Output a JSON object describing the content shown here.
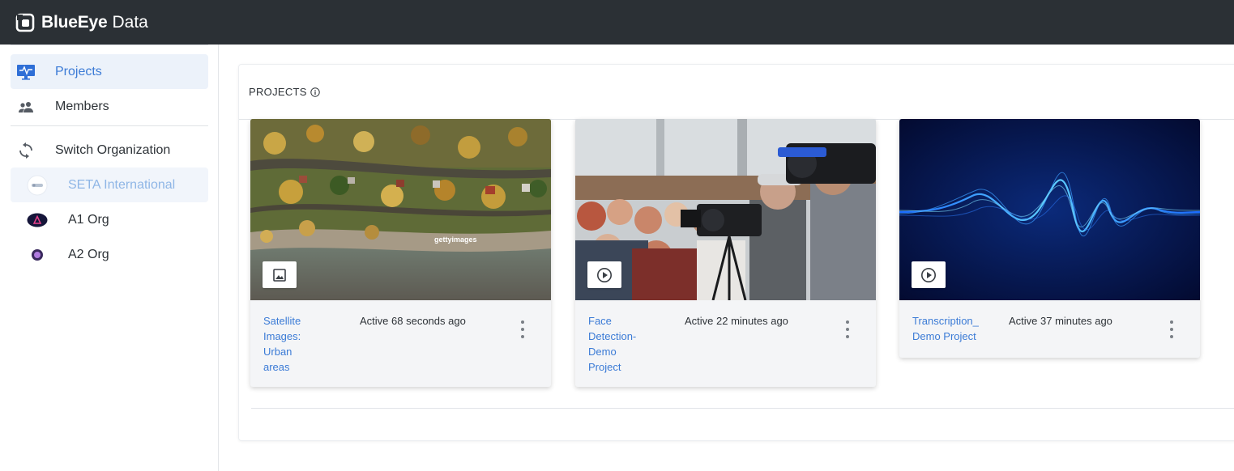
{
  "app": {
    "brand_bold": "BlueEye",
    "brand_light": "Data"
  },
  "sidebar": {
    "nav": [
      {
        "label": "Projects",
        "icon": "monitor-icon",
        "active": true
      },
      {
        "label": "Members",
        "icon": "members-icon",
        "active": false
      }
    ],
    "switch_org": {
      "label": "Switch Organization",
      "icon": "sync-icon"
    },
    "orgs": [
      {
        "label": "SETA International",
        "active": true
      },
      {
        "label": "A1 Org",
        "active": false
      },
      {
        "label": "A2 Org",
        "active": false
      }
    ]
  },
  "main": {
    "section_title": "PROJECTS",
    "projects": [
      {
        "name": "Satellite Images: Urban areas",
        "name_lines": [
          "Satellite",
          "Images:",
          "Urban",
          "areas"
        ],
        "activity": "Active 68 seconds ago",
        "media_type": "image-icon",
        "watermark": "gettyimages"
      },
      {
        "name": "Face Detection-Demo Project",
        "name_lines": [
          "Face",
          "Detection-",
          "Demo",
          "Project"
        ],
        "activity": "Active 22 minutes ago",
        "media_type": "play-circle-icon"
      },
      {
        "name": "Transcription_ Demo Project",
        "name_lines": [
          "Transcription_",
          "Demo Project"
        ],
        "activity": "Active 37 minutes ago",
        "media_type": "play-circle-icon"
      }
    ]
  },
  "colors": {
    "topbar": "#2b3035",
    "accent": "#3b7bd6",
    "active_bg": "#ecf2fa"
  }
}
